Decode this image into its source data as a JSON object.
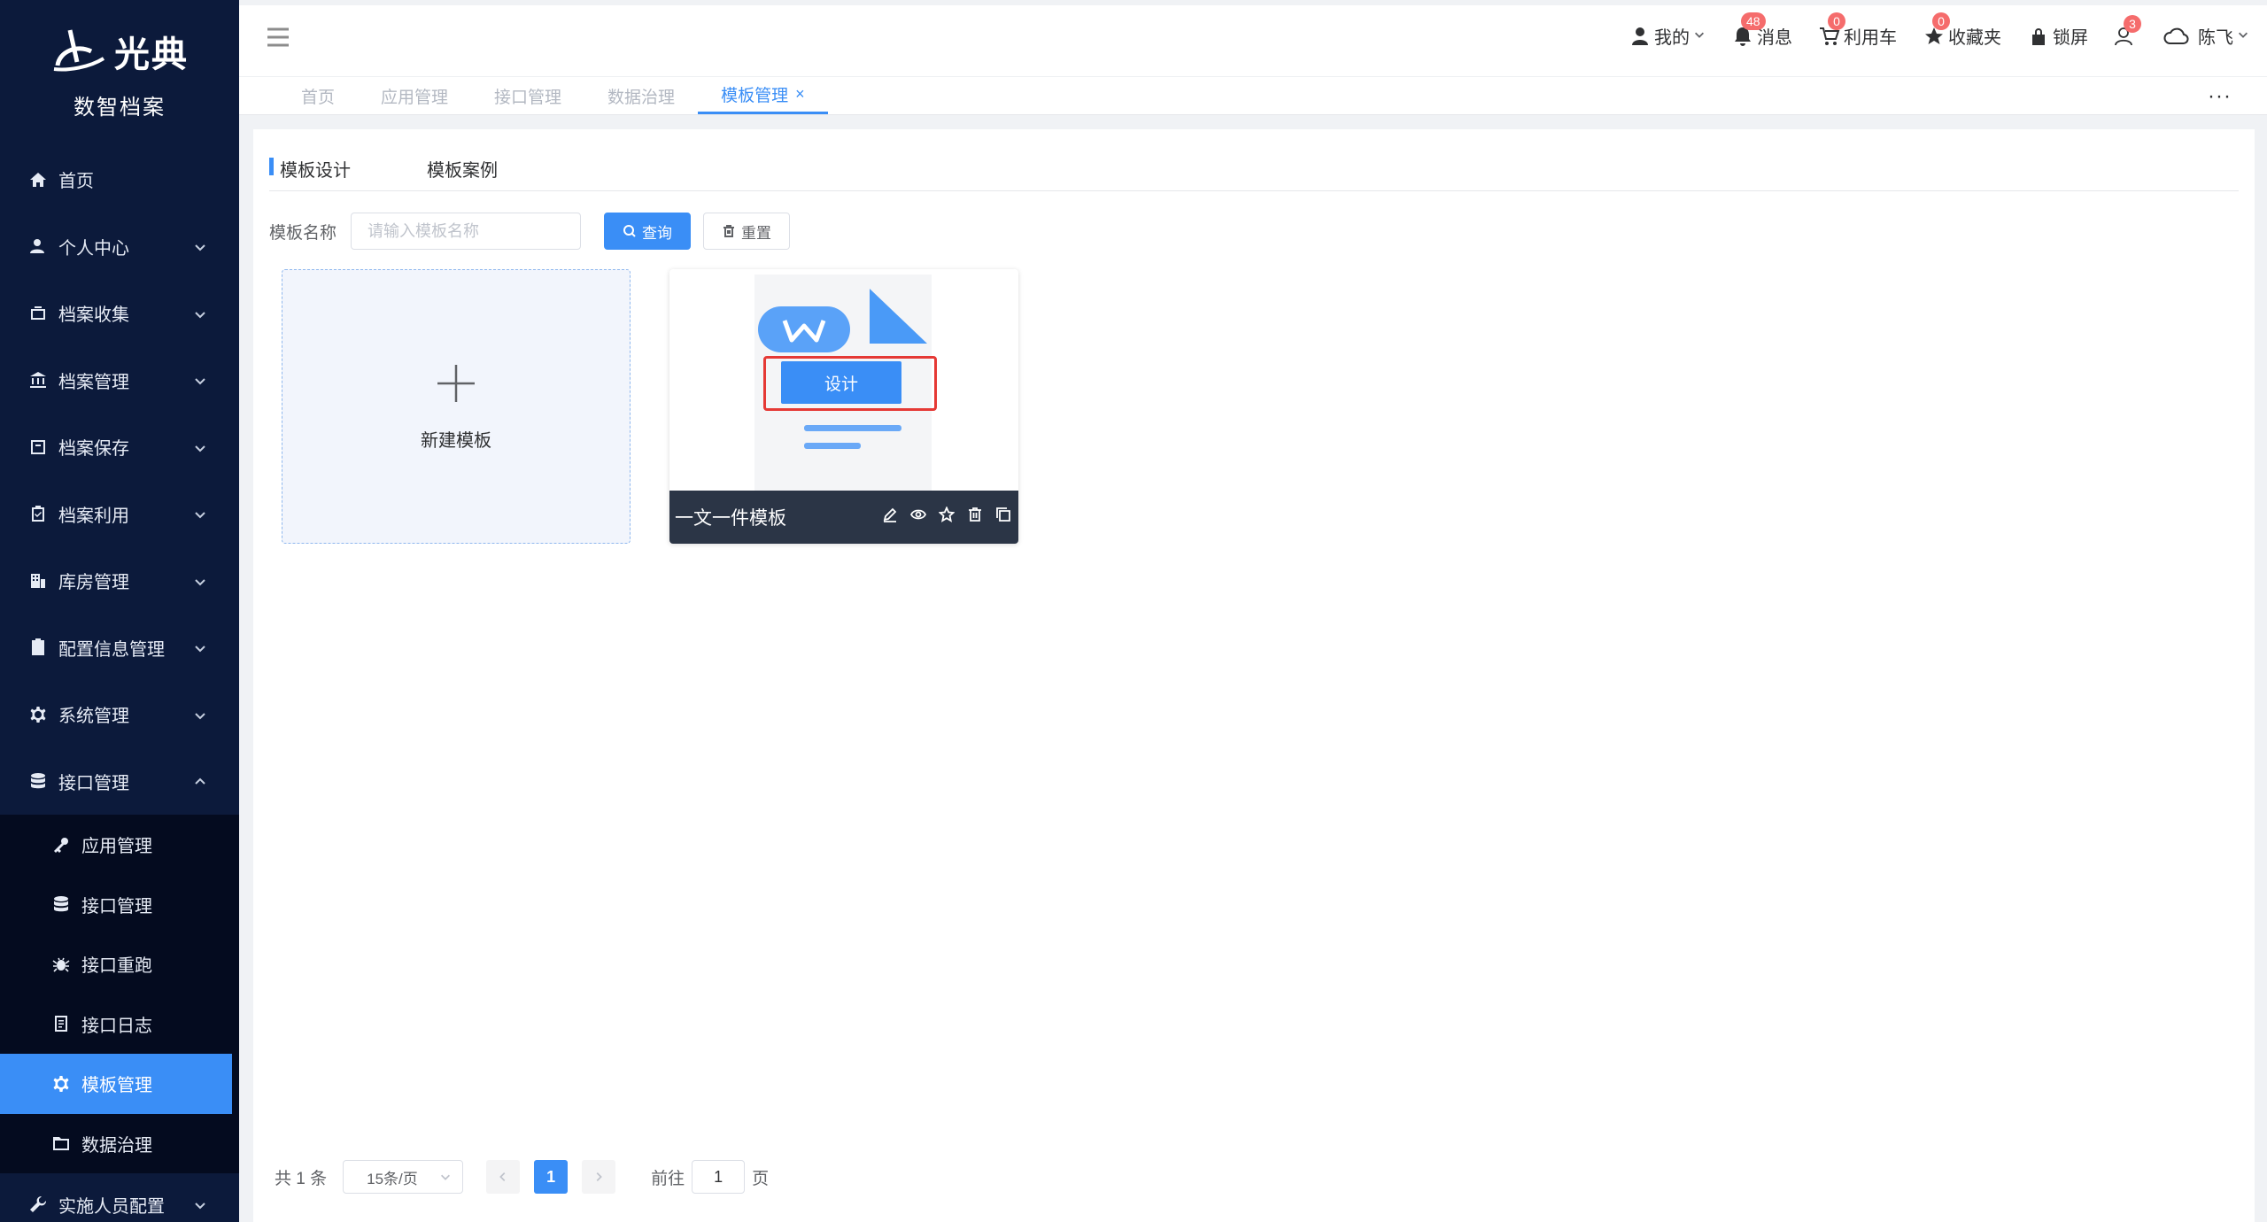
{
  "brand": {
    "logo_text": "光典",
    "subtitle": "数智档案"
  },
  "sidebar": {
    "items": [
      {
        "label": "首页",
        "icon": "home-icon"
      },
      {
        "label": "个人中心",
        "icon": "user-icon"
      },
      {
        "label": "档案收集",
        "icon": "box-icon"
      },
      {
        "label": "档案管理",
        "icon": "bank-icon"
      },
      {
        "label": "档案保存",
        "icon": "archive-icon"
      },
      {
        "label": "档案利用",
        "icon": "clipboard-icon"
      },
      {
        "label": "库房管理",
        "icon": "building-icon"
      },
      {
        "label": "配置信息管理",
        "icon": "id-card-icon"
      },
      {
        "label": "系统管理",
        "icon": "gear-icon"
      },
      {
        "label": "接口管理",
        "icon": "database-icon"
      }
    ],
    "submenu": [
      {
        "label": "应用管理",
        "icon": "key-icon"
      },
      {
        "label": "接口管理",
        "icon": "database-icon"
      },
      {
        "label": "接口重跑",
        "icon": "bug-icon"
      },
      {
        "label": "接口日志",
        "icon": "log-icon"
      },
      {
        "label": "模板管理",
        "icon": "gear-icon"
      },
      {
        "label": "数据治理",
        "icon": "folder-icon"
      }
    ],
    "last_item": {
      "label": "实施人员配置",
      "icon": "wrench-icon"
    }
  },
  "header": {
    "mine": "我的",
    "messages": {
      "label": "消息",
      "count": "48"
    },
    "cart": {
      "label": "利用车",
      "count": "0"
    },
    "favorites": {
      "label": "收藏夹",
      "count": "0"
    },
    "lock": "锁屏",
    "users_count": "3",
    "user_name": "陈飞"
  },
  "tabs": [
    {
      "label": "首页"
    },
    {
      "label": "应用管理"
    },
    {
      "label": "接口管理"
    },
    {
      "label": "数据治理"
    },
    {
      "label": "模板管理",
      "close": "×"
    }
  ],
  "tabs_more": "···",
  "inner_tabs": [
    "模板设计",
    "模板案例"
  ],
  "search": {
    "label": "模板名称",
    "placeholder": "请输入模板名称",
    "query_button": "查询",
    "reset_button": "重置"
  },
  "new_template_label": "新建模板",
  "template_card": {
    "name": "一文一件模板",
    "design_button": "设计"
  },
  "pagination": {
    "total": "共 1 条",
    "page_size": "15条/页",
    "current_page": "1",
    "goto_prefix": "前往",
    "goto_value": "1",
    "goto_suffix": "页"
  },
  "colors": {
    "sidebar_bg": "#0c1a3b",
    "accent": "#3a8ef6",
    "highlight": "#e53935",
    "badge": "#f56c6c"
  }
}
